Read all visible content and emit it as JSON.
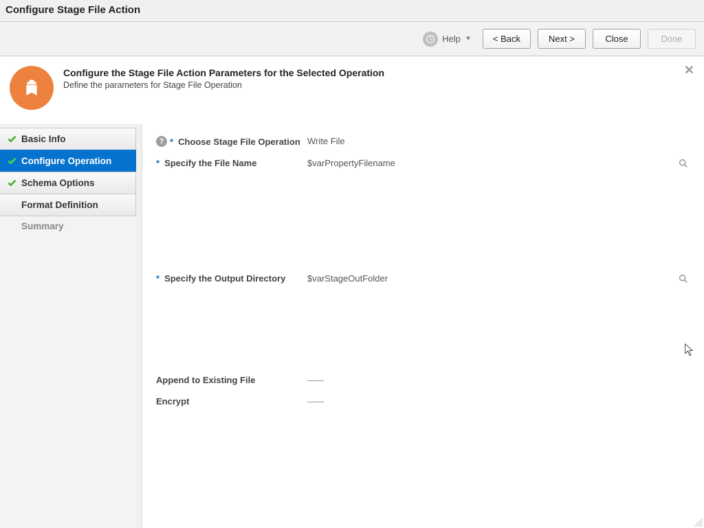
{
  "window": {
    "title": "Configure Stage File Action"
  },
  "toolbar": {
    "help": "Help",
    "back": "<  Back",
    "next": "Next  >",
    "close": "Close",
    "done": "Done"
  },
  "intro": {
    "heading": "Configure the Stage File Action Parameters for the Selected Operation",
    "sub": "Define the parameters for Stage File Operation"
  },
  "sidebar": {
    "steps": [
      {
        "label": "Basic Info",
        "check": true,
        "active": false,
        "enabled": true
      },
      {
        "label": "Configure Operation",
        "check": true,
        "active": true,
        "enabled": true
      },
      {
        "label": "Schema Options",
        "check": true,
        "active": false,
        "enabled": true
      },
      {
        "label": "Format Definition",
        "check": false,
        "active": false,
        "enabled": true
      },
      {
        "label": "Summary",
        "check": false,
        "active": false,
        "enabled": false
      }
    ]
  },
  "form": {
    "choose_label": "Choose Stage File Operation",
    "choose_value": "Write File",
    "fname_label": "Specify the File Name",
    "fname_value": "$varPropertyFilename",
    "outdir_label": "Specify the Output Directory",
    "outdir_value": "$varStageOutFolder",
    "append_label": "Append to Existing File",
    "encrypt_label": "Encrypt"
  }
}
